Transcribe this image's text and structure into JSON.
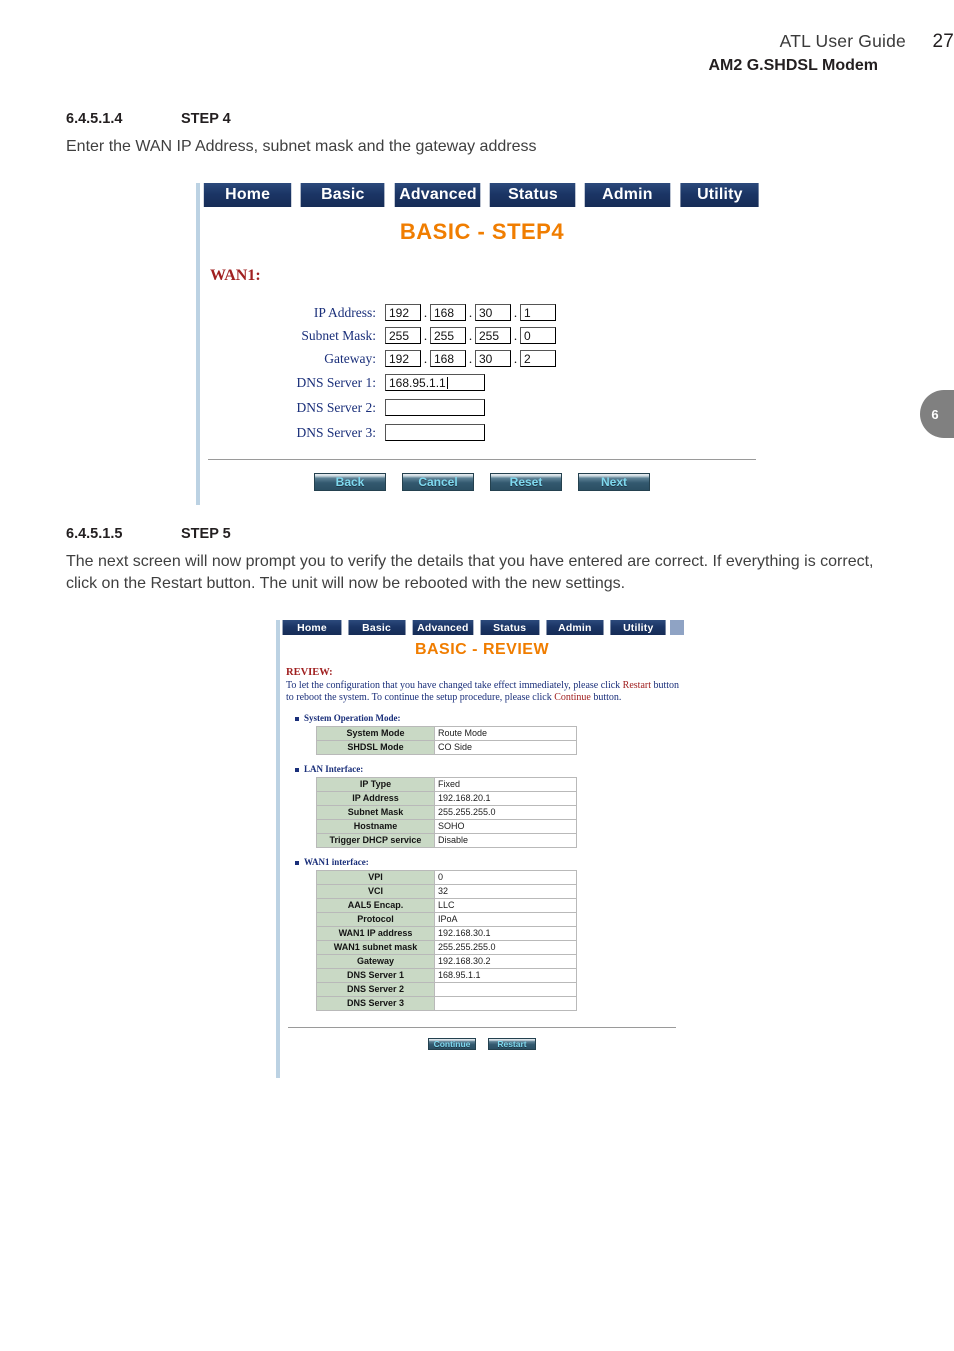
{
  "page_header": {
    "guide_title": "ATL User Guide",
    "page_number": "27",
    "product": "AM2 G.SHDSL Modem"
  },
  "chapter_tab": {
    "number": "6"
  },
  "sections": [
    {
      "number": "6.4.5.1.4",
      "title": "STEP 4",
      "body": "Enter the WAN IP Address, subnet mask and the gateway address"
    },
    {
      "number": "6.4.5.1.5",
      "title": "STEP 5",
      "body": "The next screen will now prompt you to verify the details that you have entered are correct. If everything is correct, click on the Restart button. The unit will now be rebooted with the new settings."
    }
  ],
  "screenshot_step4": {
    "nav_tabs": [
      "Home",
      "Basic",
      "Advanced",
      "Status",
      "Admin",
      "Utility"
    ],
    "title": "BASIC - STEP4",
    "section_label": "WAN1:",
    "fields": [
      {
        "label": "IP Address:",
        "type": "octets",
        "octets": [
          "192",
          "168",
          "30",
          "1"
        ]
      },
      {
        "label": "Subnet Mask:",
        "type": "octets",
        "octets": [
          "255",
          "255",
          "255",
          "0"
        ]
      },
      {
        "label": "Gateway:",
        "type": "octets",
        "octets": [
          "192",
          "168",
          "30",
          "2"
        ]
      },
      {
        "label": "DNS Server 1:",
        "type": "text",
        "value": "168.95.1.1",
        "focused": true
      },
      {
        "label": "DNS Server 2:",
        "type": "text",
        "value": "",
        "focused": false
      },
      {
        "label": "DNS Server 3:",
        "type": "text",
        "value": "",
        "focused": false
      }
    ],
    "buttons": [
      "Back",
      "Cancel",
      "Reset",
      "Next"
    ]
  },
  "screenshot_review": {
    "nav_tabs": [
      "Home",
      "Basic",
      "Advanced",
      "Status",
      "Admin",
      "Utility"
    ],
    "title": "BASIC - REVIEW",
    "review_heading": "REVIEW:",
    "review_text_part1": "To let the configuration that you have changed take effect immediately,  please click ",
    "review_highlight1": "Restart",
    "review_text_part2": " button to reboot the system.  To continue the setup procedure, please click ",
    "review_highlight2": "Continue",
    "review_text_part3": " button.",
    "groups": [
      {
        "label": "System Operation Mode:",
        "rows": [
          {
            "key": "System Mode",
            "value": "Route Mode"
          },
          {
            "key": "SHDSL Mode",
            "value": "CO Side"
          }
        ]
      },
      {
        "label": "LAN Interface:",
        "rows": [
          {
            "key": "IP Type",
            "value": "Fixed"
          },
          {
            "key": "IP Address",
            "value": "192.168.20.1"
          },
          {
            "key": "Subnet Mask",
            "value": "255.255.255.0"
          },
          {
            "key": "Hostname",
            "value": "SOHO"
          },
          {
            "key": "Trigger DHCP service",
            "value": "Disable"
          }
        ]
      },
      {
        "label": "WAN1 interface:",
        "rows": [
          {
            "key": "VPI",
            "value": "0"
          },
          {
            "key": "VCI",
            "value": "32"
          },
          {
            "key": "AAL5 Encap.",
            "value": "LLC"
          },
          {
            "key": "Protocol",
            "value": "IPoA"
          },
          {
            "key": "WAN1 IP address",
            "value": "192.168.30.1"
          },
          {
            "key": "WAN1 subnet mask",
            "value": "255.255.255.0"
          },
          {
            "key": "Gateway",
            "value": "192.168.30.2"
          },
          {
            "key": "DNS Server 1",
            "value": "168.95.1.1"
          },
          {
            "key": "DNS Server 2",
            "value": ""
          },
          {
            "key": "DNS Server 3",
            "value": ""
          }
        ]
      }
    ],
    "buttons": [
      "Continue",
      "Restart"
    ]
  },
  "colors": {
    "nav_navy": "#1b3565",
    "title_orange": "#f07d00",
    "label_navy": "#1a2f7a",
    "accent_red": "#a02020",
    "table_key_green": "#c9d9c5",
    "button_text_cyan": "#7fd8ee"
  }
}
